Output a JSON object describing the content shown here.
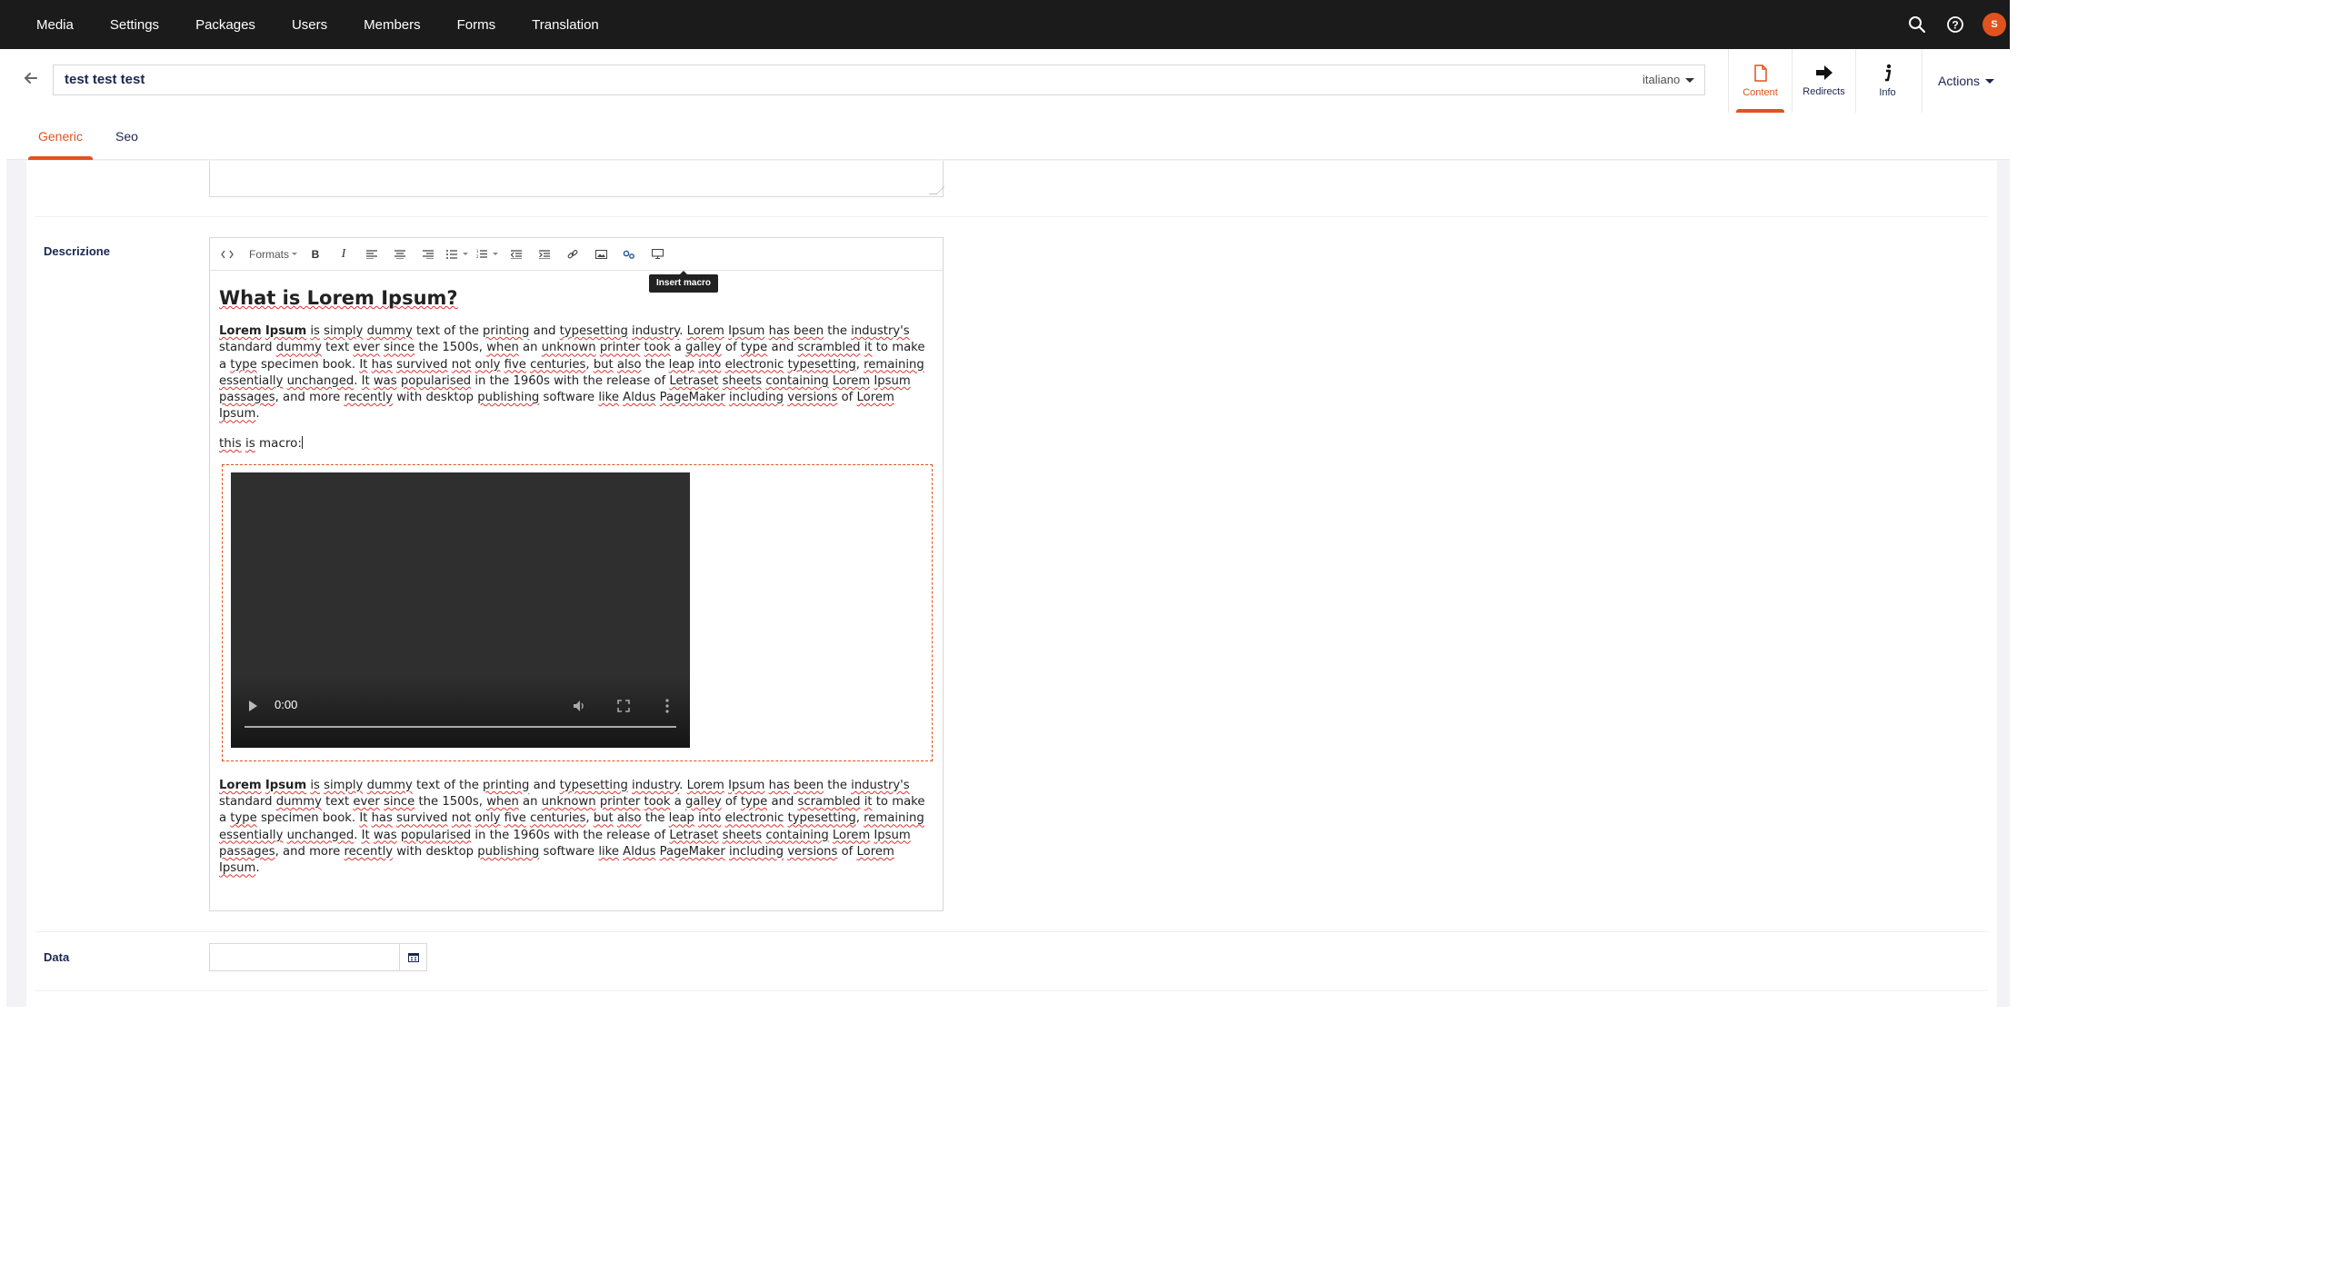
{
  "topnav": {
    "items": [
      "Media",
      "Settings",
      "Packages",
      "Users",
      "Members",
      "Forms",
      "Translation"
    ],
    "avatar_initial": "S"
  },
  "header": {
    "name_value": "test test test",
    "language": "italiano",
    "apps": [
      {
        "label": "Content",
        "icon": "document-icon",
        "active": true
      },
      {
        "label": "Redirects",
        "icon": "arrow-right-icon",
        "active": false
      },
      {
        "label": "Info",
        "icon": "info-icon",
        "active": false
      }
    ],
    "actions_label": "Actions"
  },
  "tabs": [
    {
      "label": "Generic",
      "active": true
    },
    {
      "label": "Seo",
      "active": false
    }
  ],
  "properties": {
    "description_label": "Descrizione",
    "date_label": "Data"
  },
  "rte": {
    "toolbar": {
      "formats_label": "Formats",
      "bold_label": "B",
      "italic_label": "I",
      "tooltip": "Insert macro"
    },
    "heading": "What is Lorem Ipsum?",
    "paragraph_before": "Lorem Ipsum is simply dummy text of the printing and typesetting industry. Lorem Ipsum has been the industry's standard dummy text ever since the 1500s, when an unknown printer took a galley of type and scrambled it to make a type specimen book. It has survived not only five centuries, but also the leap into electronic typesetting, remaining essentially unchanged. It was popularised in the 1960s with the release of Letraset sheets containing Lorem Ipsum passages, and more recently with desktop publishing software like Aldus PageMaker including versions of Lorem Ipsum.",
    "macro_line": "this is macro:",
    "video_time": "0:00",
    "paragraph_after": "Lorem Ipsum is simply dummy text of the printing and typesetting industry. Lorem Ipsum has been the industry's standard dummy text ever since the 1500s, when an unknown printer took a galley of type and scrambled it to make a type specimen book. It has survived not only five centuries, but also the leap into electronic typesetting, remaining essentially unchanged. It was popularised in the 1960s with the release of Letraset sheets containing Lorem Ipsum passages, and more recently with desktop publishing software like Aldus PageMaker including versions of Lorem Ipsum."
  },
  "colors": {
    "accent": "#e0531f",
    "topbar": "#1b1b1b",
    "text": "#1b264f"
  }
}
